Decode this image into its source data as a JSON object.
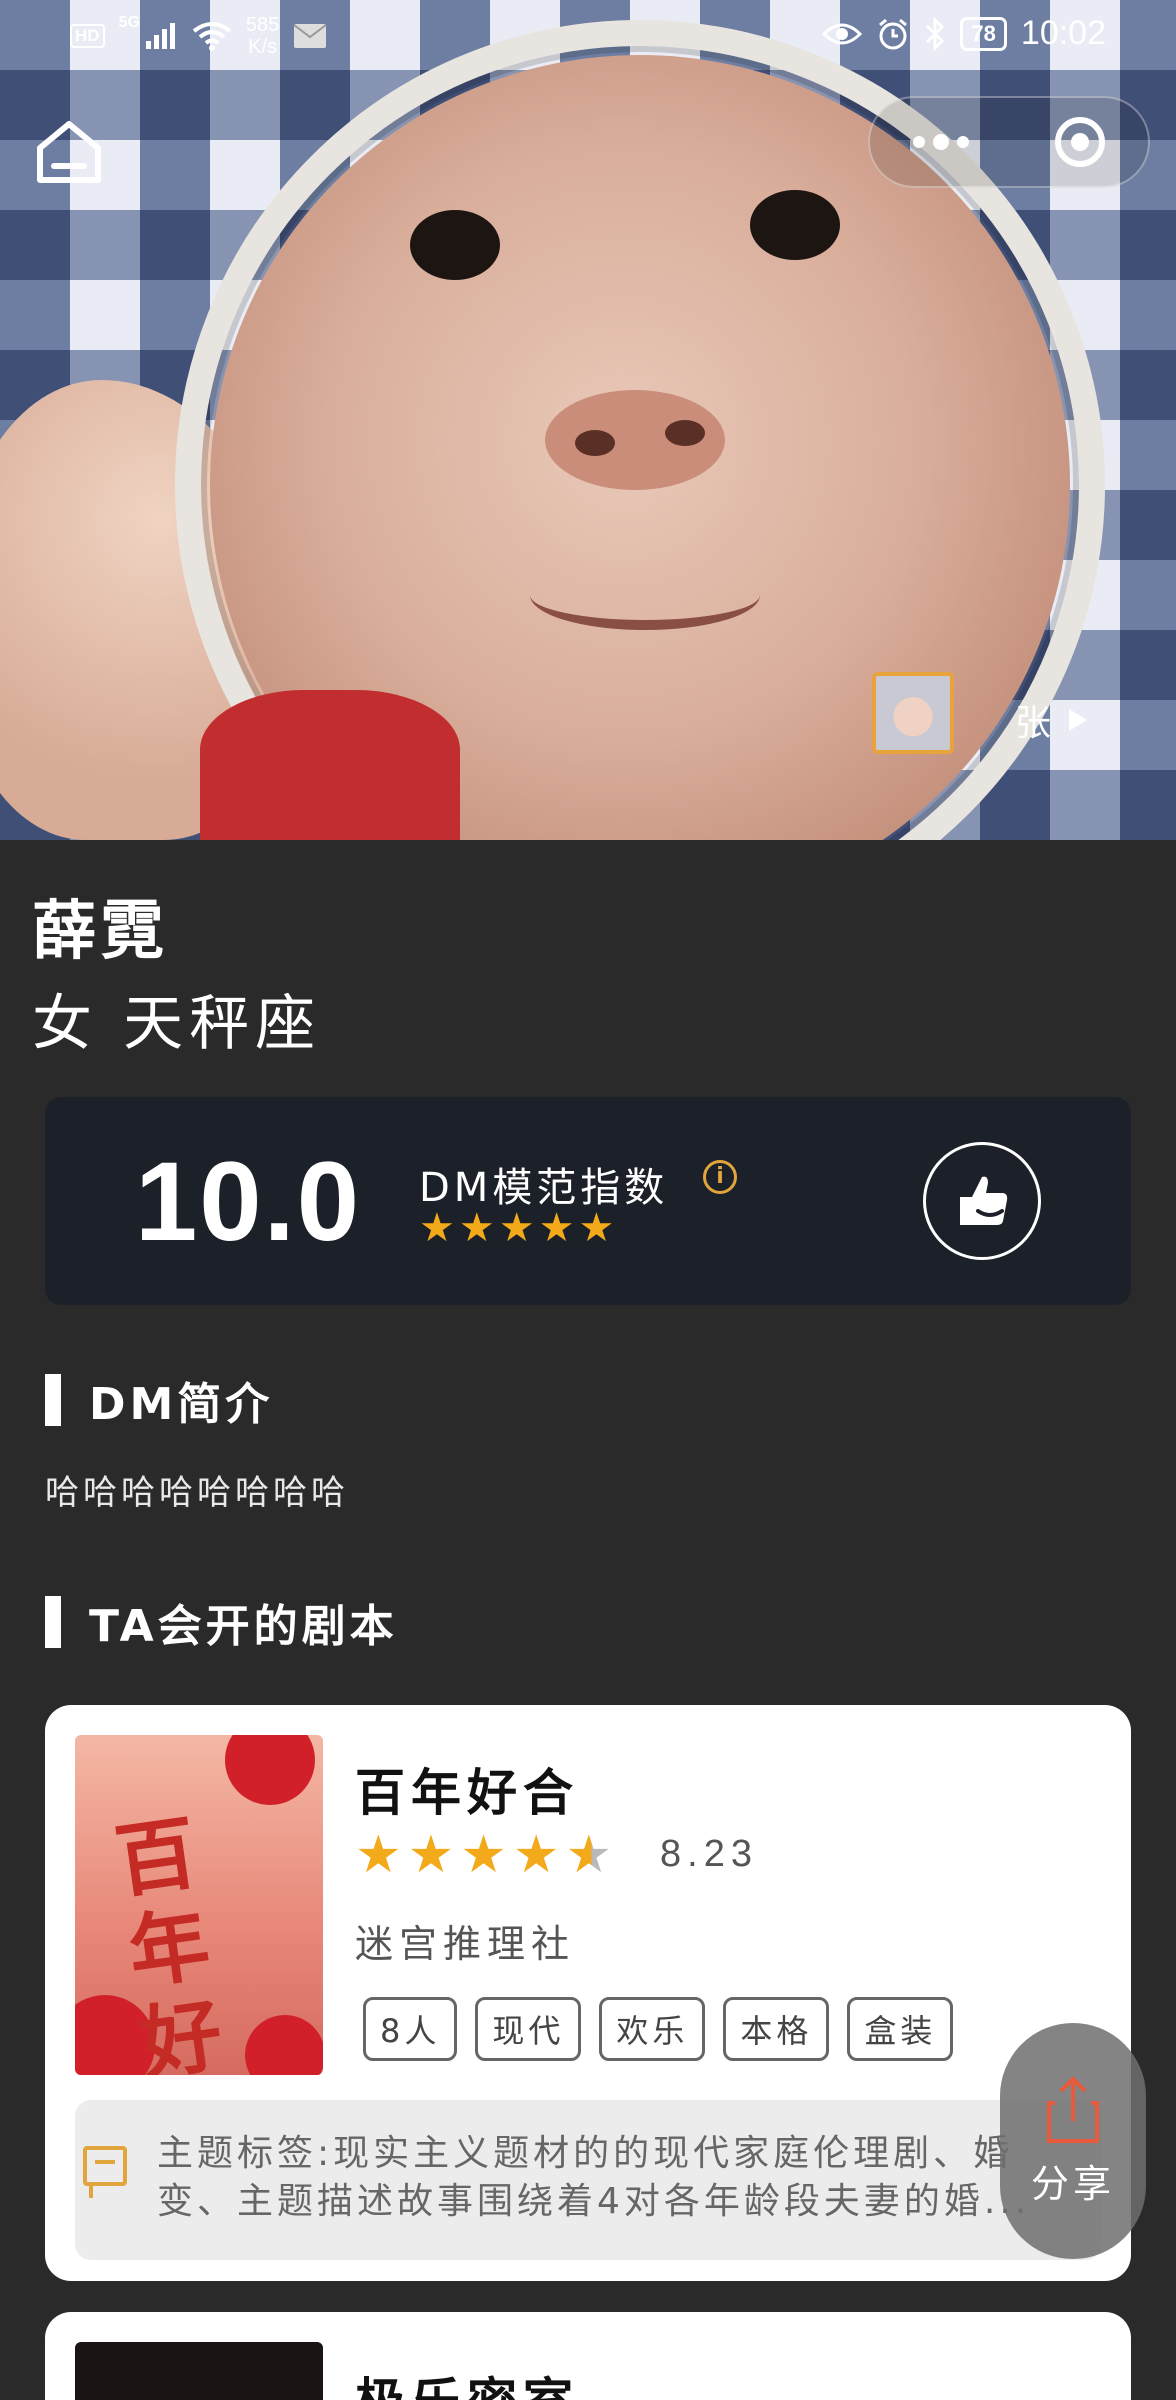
{
  "status_bar": {
    "network_badges": [
      "HD",
      "5G"
    ],
    "speed": "585",
    "speed_unit": "K/s",
    "battery": "78",
    "time": "10:02"
  },
  "hero": {
    "page_indicator": "张"
  },
  "profile": {
    "name": "薛霓",
    "gender_sign": "女 天秤座"
  },
  "score": {
    "value": "10.0",
    "label": "DM模范指数",
    "info_glyph": "i",
    "stars": [
      "★",
      "★",
      "★",
      "★",
      "★"
    ],
    "stars_count": 5
  },
  "sections": {
    "intro_title": "DM简介",
    "intro_text": "哈哈哈哈哈哈哈哈",
    "scripts_title": "TA会开的剧本"
  },
  "scripts": [
    {
      "title": "百年好合",
      "poster_text": "百年好合",
      "rating_stars": 4.5,
      "rating": "8.23",
      "publisher": "迷宫推理社",
      "tags": [
        "8人",
        "现代",
        "欢乐",
        "本格",
        "盒装"
      ],
      "theme": "主题标签:现实主义题材的的现代家庭伦理剧、婚变、主题描述故事围绕着4对各年龄段夫妻的婚..."
    },
    {
      "title": "极乐密室"
    }
  ],
  "share": {
    "label": "分享"
  },
  "colors": {
    "background": "#2a2a2b",
    "score_card": "#1c2029",
    "star": "#f2a91a",
    "accent": "#e0a53c"
  }
}
